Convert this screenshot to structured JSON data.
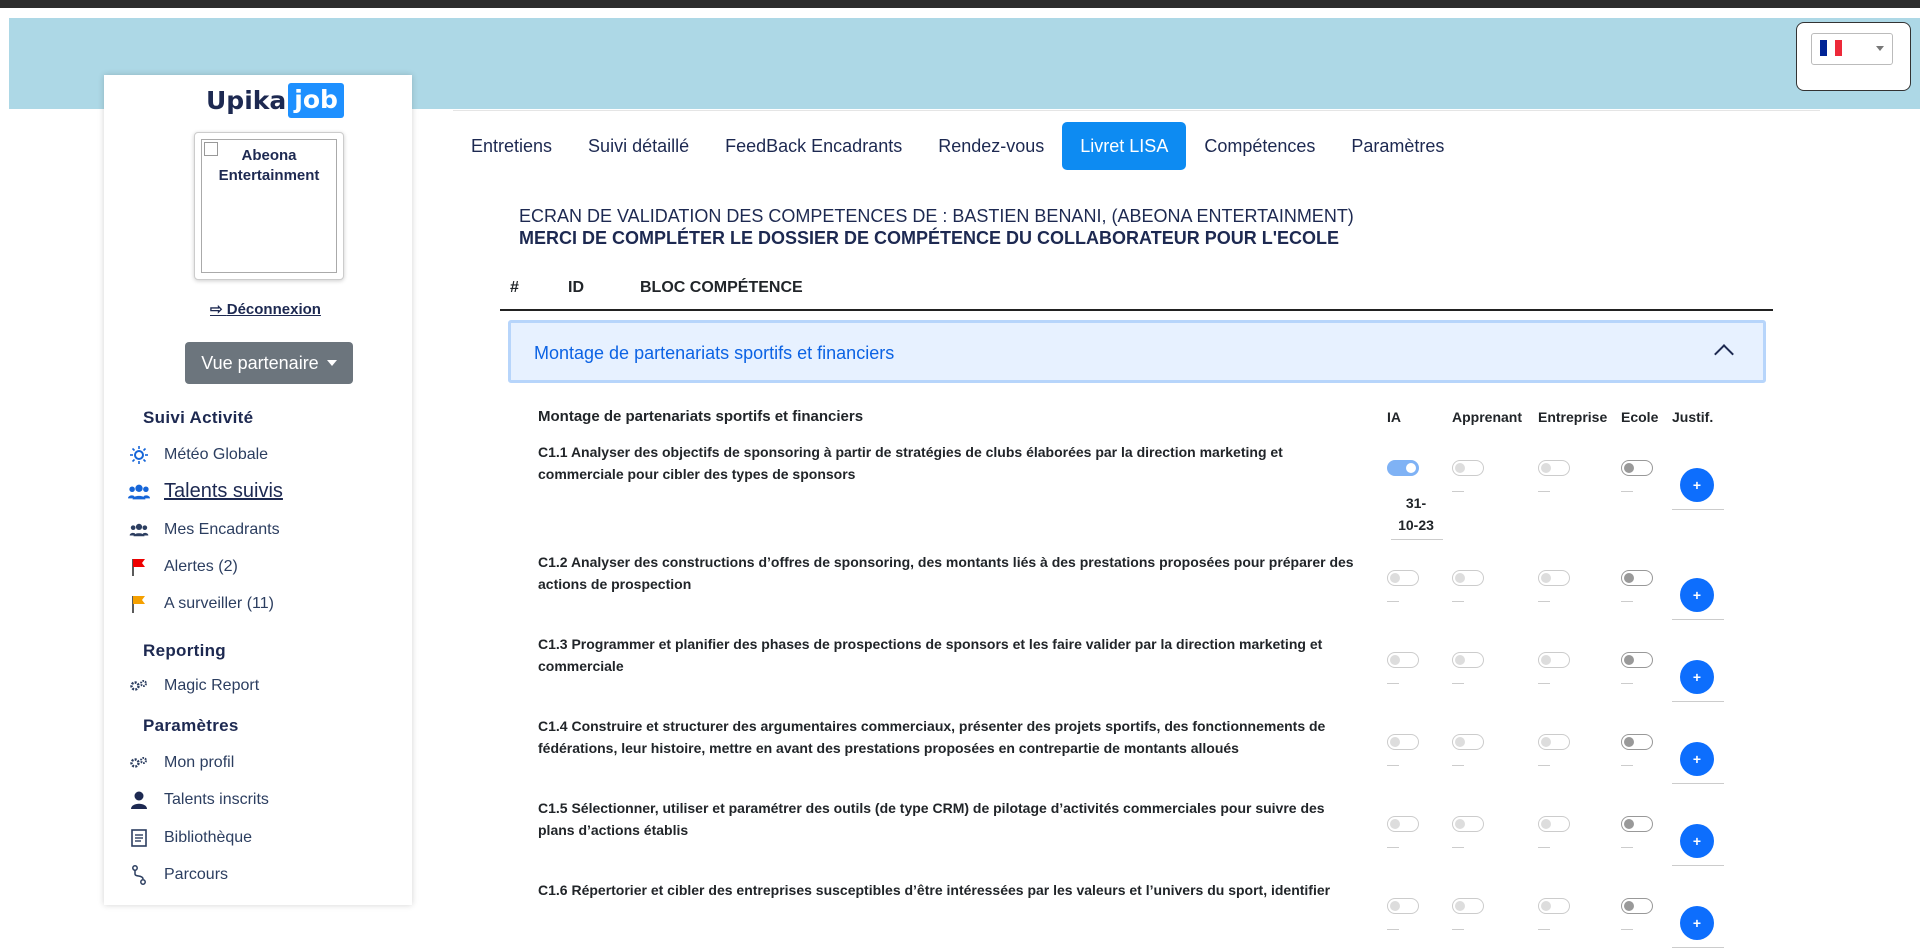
{
  "brand": {
    "part1": "Upika",
    "part2": "job"
  },
  "profile": {
    "alt_text": "Abeona Entertainment",
    "logout": "Déconnexion"
  },
  "partner_view": "Vue partenaire",
  "sidebar": {
    "sections": [
      {
        "title": "Suivi Activité"
      },
      {
        "title": "Reporting"
      },
      {
        "title": "Paramètres"
      }
    ],
    "items": [
      {
        "label": "Météo Globale",
        "icon": "sun-icon"
      },
      {
        "label": " Talents suivis",
        "icon": "users-icon"
      },
      {
        "label": "Mes Encadrants",
        "icon": "users-small-icon"
      },
      {
        "label": "Alertes (2)",
        "icon": "red-flag-icon"
      },
      {
        "label": "A surveiller (11)",
        "icon": "orange-flag-icon"
      },
      {
        "label": "Magic Report",
        "icon": "gears-icon"
      },
      {
        "label": "Mon profil",
        "icon": "gears-icon"
      },
      {
        "label": "Talents inscrits",
        "icon": "user-icon"
      },
      {
        "label": "Bibliothèque",
        "icon": "book-icon"
      },
      {
        "label": "Parcours",
        "icon": "route-icon"
      }
    ]
  },
  "tabs": [
    {
      "label": "Entretiens",
      "active": false
    },
    {
      "label": "Suivi détaillé",
      "active": false
    },
    {
      "label": "FeedBack Encadrants",
      "active": false
    },
    {
      "label": "Rendez-vous",
      "active": false
    },
    {
      "label": "Livret LISA",
      "active": true
    },
    {
      "label": "Compétences",
      "active": false
    },
    {
      "label": "Paramètres",
      "active": false
    }
  ],
  "heading": {
    "line1": "ECRAN DE VALIDATION DES COMPETENCES DE : BASTIEN BENANI, (ABEONA ENTERTAINMENT)",
    "line2": "MERCI DE COMPLÉTER LE DOSSIER DE COMPÉTENCE DU COLLABORATEUR POUR L'ECOLE"
  },
  "table_header": {
    "num": "#",
    "id": "ID",
    "bloc": "BLOC COMPÉTENCE"
  },
  "accordion": {
    "title": "Montage de partenariats sportifs et financiers"
  },
  "competences": {
    "title": "Montage de partenariats sportifs et financiers",
    "columns": {
      "ia": "IA",
      "apprenant": "Apprenant",
      "entreprise": "Entreprise",
      "ecole": "Ecole",
      "justif": "Justif."
    },
    "plus_label": "+",
    "rows": [
      {
        "line1": "C1.1 Analyser des objectifs de sponsoring à partir de stratégies de clubs élaborées par la direction marketing et",
        "line2": "commerciale pour cibler des types de sponsors",
        "ia_on": true,
        "date_a": "31-",
        "date_b": "10-23"
      },
      {
        "line1": "C1.2 Analyser des constructions d’offres de sponsoring, des montants liés à des prestations proposées pour préparer des",
        "line2": "actions de prospection",
        "ia_on": false
      },
      {
        "line1": "C1.3 Programmer et planifier des phases de prospections de sponsors et les faire valider par la direction marketing et",
        "line2": "commerciale",
        "ia_on": false
      },
      {
        "line1": "C1.4 Construire et structurer des argumentaires commerciaux, présenter des projets sportifs, des fonctionnements de",
        "line2": "fédérations, leur histoire, mettre en avant des prestations proposées en contrepartie de montants alloués",
        "ia_on": false
      },
      {
        "line1": "C1.5 Sélectionner, utiliser et paramétrer des outils (de type CRM) de pilotage d’activités commerciales pour suivre des",
        "line2": "plans d’actions établis",
        "ia_on": false
      },
      {
        "line1": "C1.6 Répertorier et cibler des entreprises susceptibles d’être intéressées par les valeurs et l’univers du sport, identifier",
        "line2": "",
        "ia_on": false
      }
    ]
  },
  "colors": {
    "banner": "#add8e6",
    "accent": "#0d8bf2",
    "navy": "#1d2951"
  }
}
